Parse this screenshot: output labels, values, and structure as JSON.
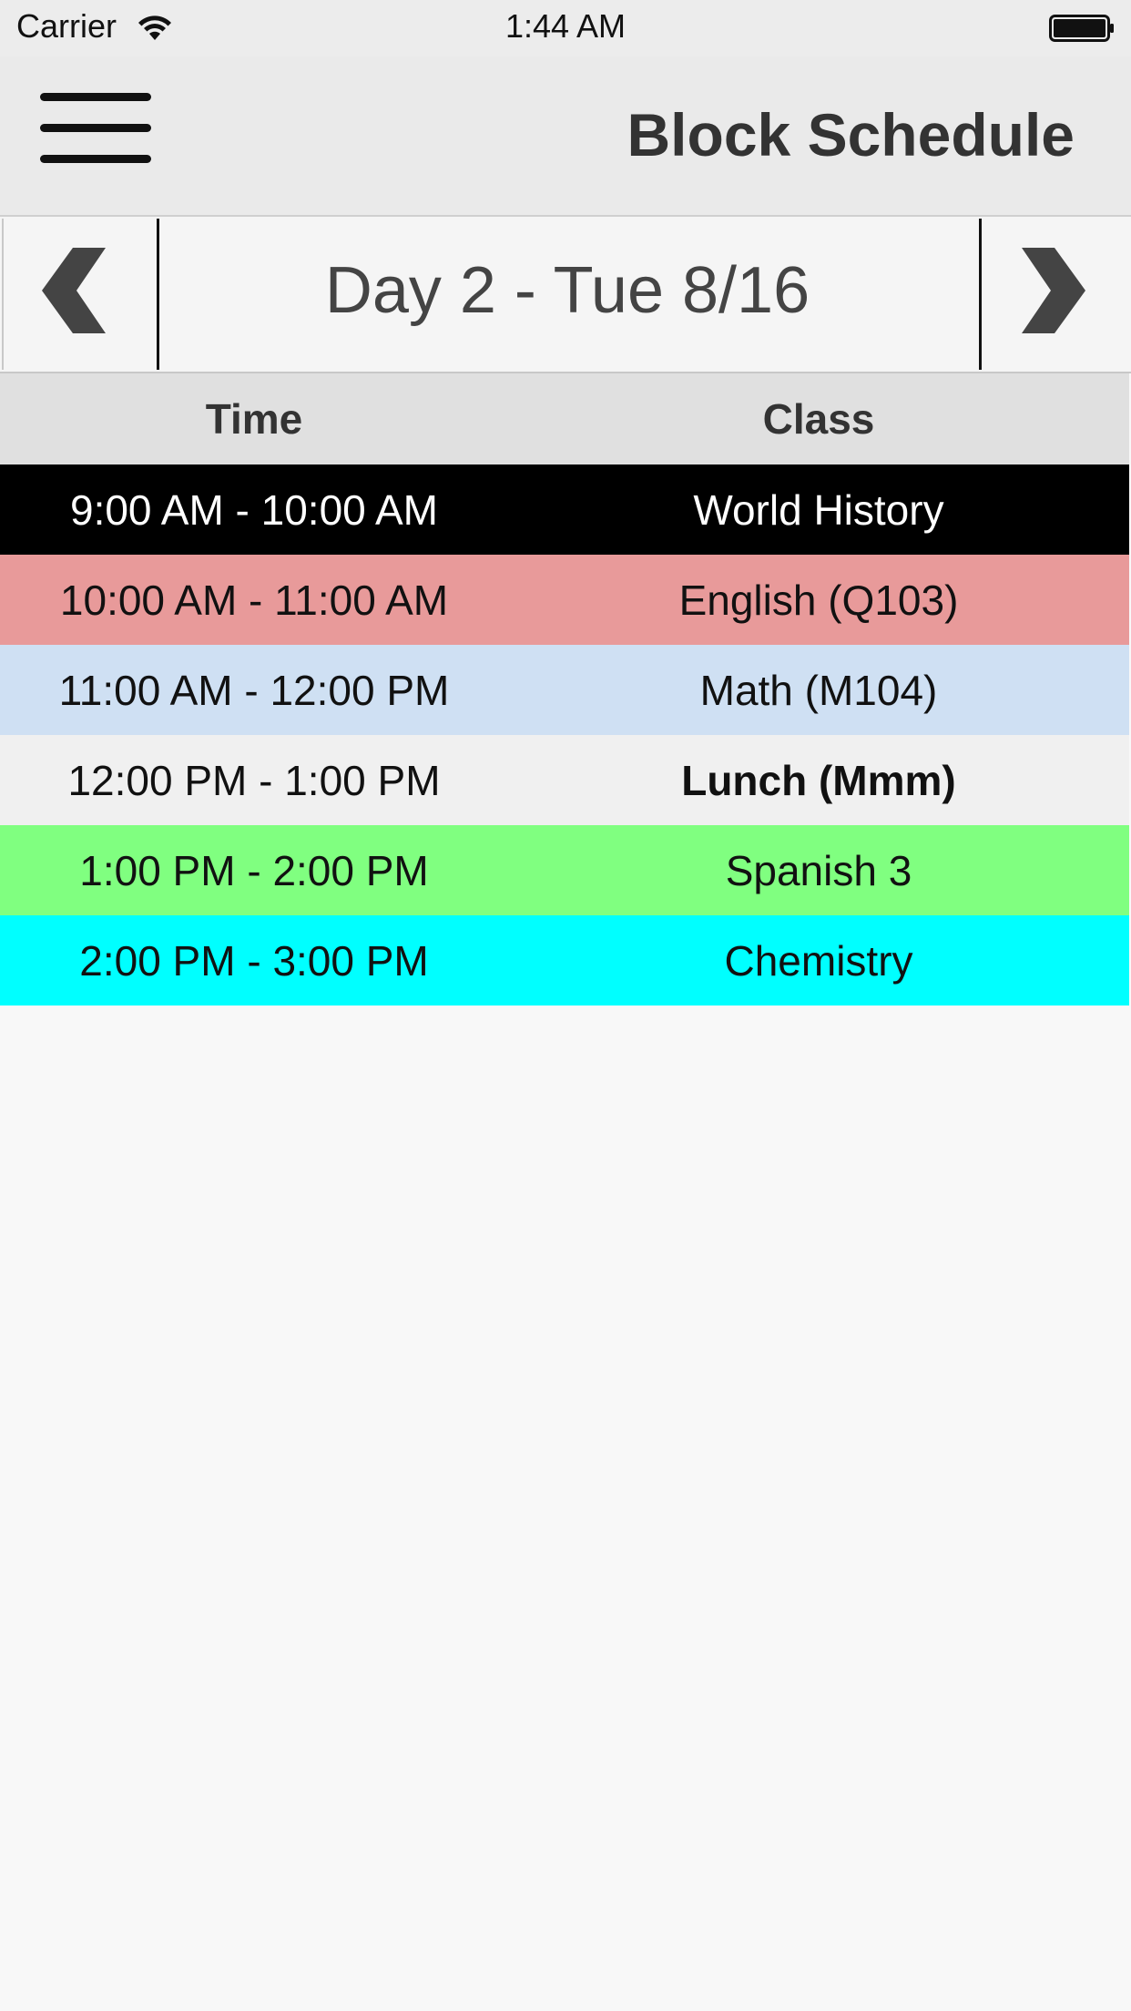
{
  "status_bar": {
    "carrier": "Carrier",
    "time": "1:44 AM",
    "wifi_icon": "wifi-icon",
    "battery_icon": "battery-icon"
  },
  "nav_bar": {
    "menu_icon": "hamburger-menu-icon",
    "title": "Block Schedule"
  },
  "day_nav": {
    "prev_icon": "chevron-left-icon",
    "next_icon": "chevron-right-icon",
    "label": "Day 2 - Tue 8/16"
  },
  "table": {
    "headers": [
      "Time",
      "Class"
    ],
    "rows": [
      {
        "time": "9:00 AM - 10:00 AM",
        "class": "World History",
        "color": "#000000"
      },
      {
        "time": "10:00 AM - 11:00 AM",
        "class": "English (Q103)",
        "color": "#e89a9a"
      },
      {
        "time": "11:00 AM - 12:00 PM",
        "class": "Math (M104)",
        "color": "#cfe0f3"
      },
      {
        "time": "12:00 PM - 1:00 PM",
        "class": "Lunch (Mmm)",
        "color": "#f0f0f0"
      },
      {
        "time": "1:00 PM - 2:00 PM",
        "class": "Spanish 3",
        "color": "#80ff80"
      },
      {
        "time": "2:00 PM - 3:00 PM",
        "class": "Chemistry",
        "color": "#00ffff"
      }
    ]
  }
}
